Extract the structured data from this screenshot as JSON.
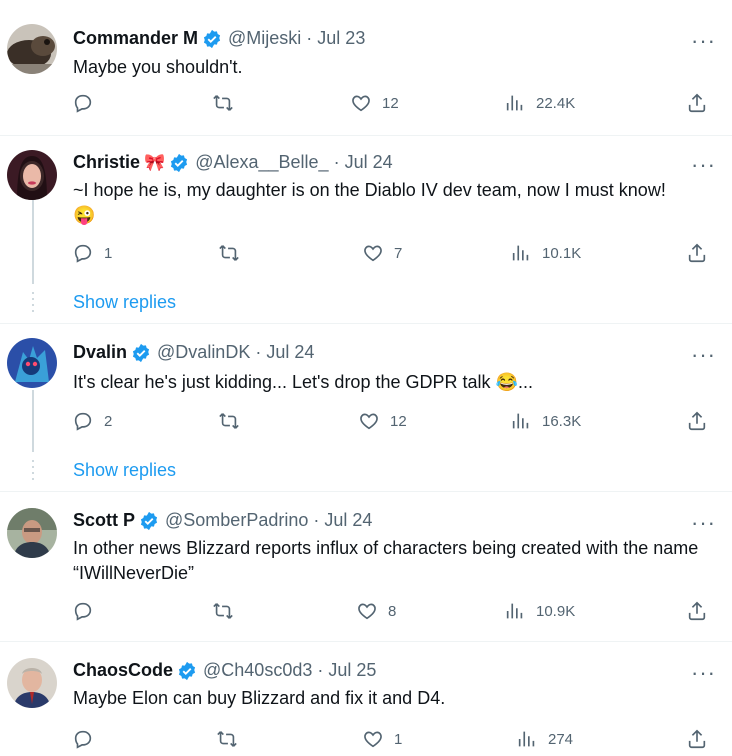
{
  "tweets": [
    {
      "name": "Commander M",
      "name_emoji": "",
      "handle": "@Mijeski",
      "separator": "·",
      "date": "Jul 23",
      "text": "Maybe you shouldn't.",
      "text_emoji": "",
      "replies": "",
      "retweets": "",
      "likes": "12",
      "views": "22.4K"
    },
    {
      "name": "Christie",
      "name_emoji": "🎀",
      "handle": "@Alexa__Belle_",
      "separator": "·",
      "date": "Jul 24",
      "text": "~I hope he is, my daughter is on the Diablo IV dev team, now I must know!",
      "text_emoji": "😜",
      "replies": "1",
      "retweets": "",
      "likes": "7",
      "views": "10.1K",
      "show_replies": "Show replies"
    },
    {
      "name": "Dvalin",
      "name_emoji": "",
      "handle": "@DvalinDK",
      "separator": "·",
      "date": "Jul 24",
      "text": "It's clear he's just kidding... Let's drop the GDPR talk",
      "text_emoji": "😂",
      "text_after": "...",
      "replies": "2",
      "retweets": "",
      "likes": "12",
      "views": "16.3K",
      "show_replies": "Show replies"
    },
    {
      "name": "Scott P",
      "name_emoji": "",
      "handle": "@SomberPadrino",
      "separator": "·",
      "date": "Jul 24",
      "text": "In other news Blizzard reports influx of characters being created with the name “IWillNeverDie”",
      "text_emoji": "",
      "replies": "",
      "retweets": "",
      "likes": "8",
      "views": "10.9K"
    },
    {
      "name": "ChaosCode",
      "name_emoji": "",
      "handle": "@Ch40sc0d3",
      "separator": "·",
      "date": "Jul 25",
      "text": "Maybe Elon can buy Blizzard and fix it and D4.",
      "text_emoji": "",
      "replies": "",
      "retweets": "",
      "likes": "1",
      "views": "274"
    }
  ],
  "more_glyph": "···",
  "colors": {
    "verified": "#1d9bf0",
    "link": "#1d9bf0",
    "muted": "#536471",
    "text": "#0f1419"
  },
  "icons": [
    "reply-icon",
    "retweet-icon",
    "like-icon",
    "views-icon",
    "share-icon",
    "verified-badge-icon",
    "more-icon"
  ]
}
